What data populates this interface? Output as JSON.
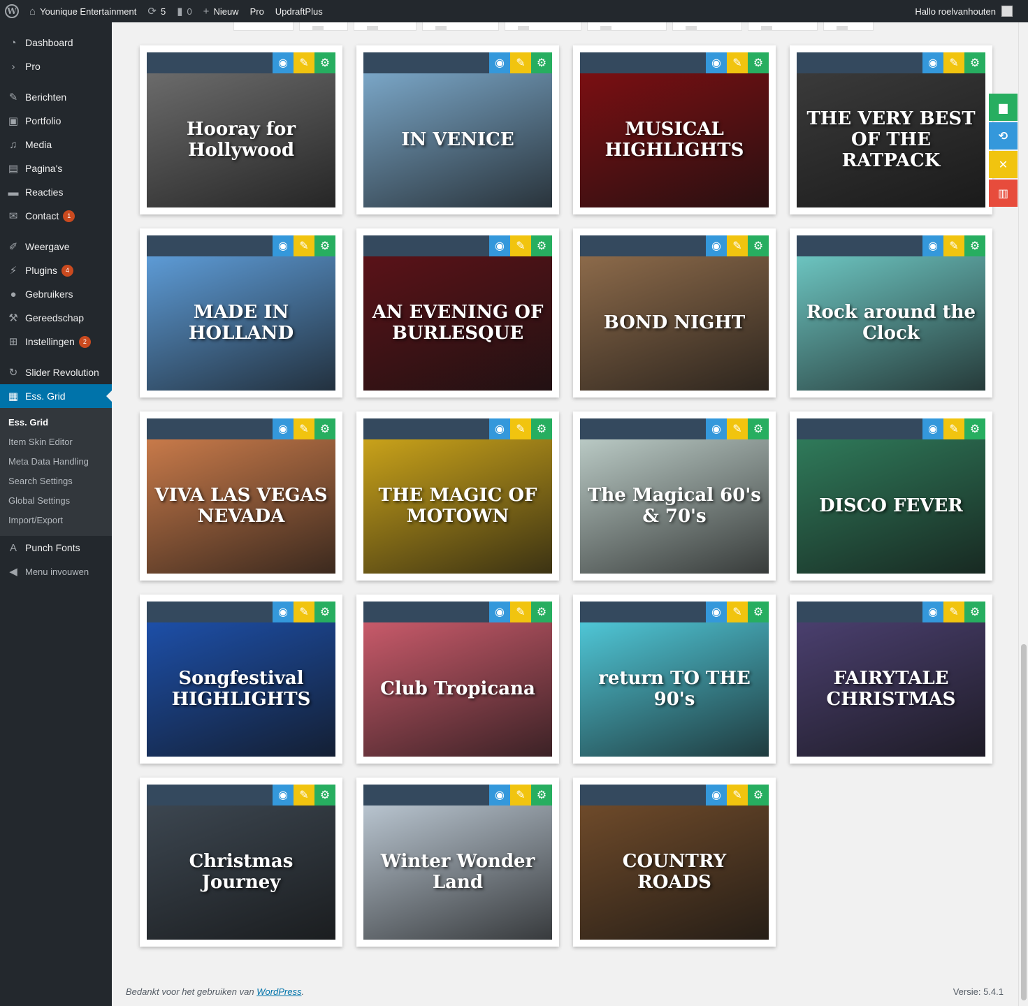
{
  "adminbar": {
    "site_name": "Younique Entertainment",
    "updates_count": "5",
    "comments_count": "0",
    "new_label": "Nieuw",
    "pro_label": "Pro",
    "updraft_label": "UpdraftPlus",
    "greeting": "Hallo roelvanhouten"
  },
  "sidebar": {
    "items": [
      {
        "label": "Dashboard",
        "icon": "dashboard-icon"
      },
      {
        "label": "Pro",
        "icon": "chevron-right-icon"
      },
      {
        "label": "Berichten",
        "icon": "pin-icon"
      },
      {
        "label": "Portfolio",
        "icon": "portfolio-icon"
      },
      {
        "label": "Media",
        "icon": "media-icon"
      },
      {
        "label": "Pagina's",
        "icon": "page-icon"
      },
      {
        "label": "Reacties",
        "icon": "comment-icon"
      },
      {
        "label": "Contact",
        "icon": "mail-icon",
        "badge": "1"
      },
      {
        "label": "Weergave",
        "icon": "brush-icon"
      },
      {
        "label": "Plugins",
        "icon": "plugin-icon",
        "badge": "4"
      },
      {
        "label": "Gebruikers",
        "icon": "user-icon"
      },
      {
        "label": "Gereedschap",
        "icon": "wrench-icon"
      },
      {
        "label": "Instellingen",
        "icon": "settings-icon",
        "badge": "2"
      },
      {
        "label": "Slider Revolution",
        "icon": "refresh-icon"
      },
      {
        "label": "Ess. Grid",
        "icon": "grid-icon"
      },
      {
        "label": "Punch Fonts",
        "icon": "font-icon"
      },
      {
        "label": "Menu invouwen",
        "icon": "collapse-icon"
      }
    ],
    "submenu": [
      "Ess. Grid",
      "Item Skin Editor",
      "Meta Data Handling",
      "Search Settings",
      "Global Settings",
      "Import/Export"
    ]
  },
  "colors": {
    "eye": "#3498db",
    "pen": "#f1c40f",
    "gear": "#27ae60",
    "delete": "#e74c3c",
    "header_strip": "#34495e",
    "admin_blue": "#0073aa"
  },
  "cards": [
    {
      "title": "Hooray for Hollywood",
      "color": "#6b6b6b"
    },
    {
      "title": "IN VENICE",
      "color": "#7aa6c7"
    },
    {
      "title": "MUSICAL HIGHLIGHTS",
      "color": "#7a0f12"
    },
    {
      "title": "THE VERY BEST OF THE RATPACK",
      "color": "#3a3a3a"
    },
    {
      "title": "MADE IN HOLLAND",
      "color": "#5d9bd6"
    },
    {
      "title": "AN EVENING OF BURLESQUE",
      "color": "#5a1218"
    },
    {
      "title": "BOND NIGHT",
      "color": "#8c6a4a"
    },
    {
      "title": "Rock around the Clock",
      "color": "#6cc4c0"
    },
    {
      "title": "VIVA LAS VEGAS NEVADA",
      "color": "#c87a4a"
    },
    {
      "title": "THE MAGIC OF MOTOWN",
      "color": "#c9a21a"
    },
    {
      "title": "The Magical 60's & 70's",
      "color": "#b9c9c4"
    },
    {
      "title": "DISCO FEVER",
      "color": "#2f7a5a"
    },
    {
      "title": "Songfestival HIGHLIGHTS",
      "color": "#1d4fa8"
    },
    {
      "title": "Club Tropicana",
      "color": "#c85a6a"
    },
    {
      "title": "return TO THE 90's",
      "color": "#4fc6d6"
    },
    {
      "title": "FAIRYTALE CHRISTMAS",
      "color": "#4a3f6e"
    },
    {
      "title": "Christmas Journey",
      "color": "#3c4650"
    },
    {
      "title": "Winter Wonder Land",
      "color": "#b8c4cf"
    },
    {
      "title": "COUNTRY ROADS",
      "color": "#6e4a2a"
    }
  ],
  "footer": {
    "thanks_prefix": "Bedankt voor het gebruiken van ",
    "wp_link": "WordPress",
    "thanks_suffix": ".",
    "version": "Versie: 5.4.1"
  }
}
